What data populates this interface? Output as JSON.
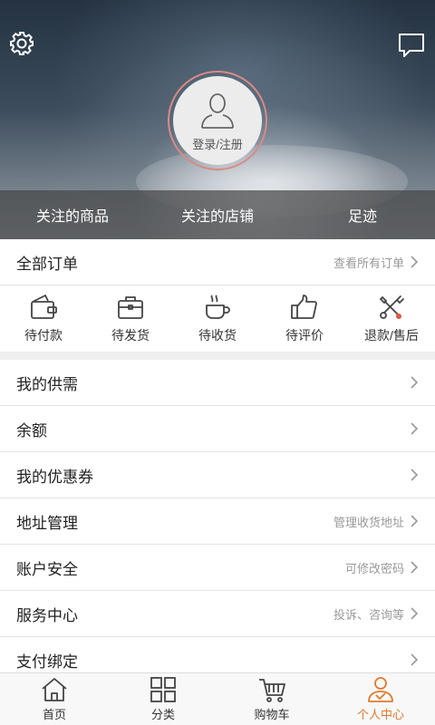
{
  "header": {
    "avatar_label": "登录/注册",
    "stats": [
      {
        "label": "关注的商品"
      },
      {
        "label": "关注的店铺"
      },
      {
        "label": "足迹"
      }
    ]
  },
  "orders": {
    "title": "全部订单",
    "view_all": "查看所有订单",
    "statuses": [
      {
        "label": "待付款",
        "icon": "wallet-icon"
      },
      {
        "label": "待发货",
        "icon": "briefcase-icon"
      },
      {
        "label": "待收货",
        "icon": "coffee-cup-icon"
      },
      {
        "label": "待评价",
        "icon": "thumbs-up-icon"
      },
      {
        "label": "退款/售后",
        "icon": "tools-icon"
      }
    ]
  },
  "menu": [
    {
      "label": "我的供需",
      "hint": ""
    },
    {
      "label": "余额",
      "hint": ""
    },
    {
      "label": "我的优惠券",
      "hint": ""
    },
    {
      "label": "地址管理",
      "hint": "管理收货地址"
    },
    {
      "label": "账户安全",
      "hint": "可修改密码"
    },
    {
      "label": "服务中心",
      "hint": "投诉、咨询等"
    },
    {
      "label": "支付绑定",
      "hint": ""
    }
  ],
  "tabbar": {
    "tabs": [
      {
        "label": "首页",
        "icon": "home-icon"
      },
      {
        "label": "分类",
        "icon": "grid-icon"
      },
      {
        "label": "购物车",
        "icon": "cart-icon"
      },
      {
        "label": "个人中心",
        "icon": "profile-icon"
      }
    ],
    "active_color": "#e07a2c"
  }
}
